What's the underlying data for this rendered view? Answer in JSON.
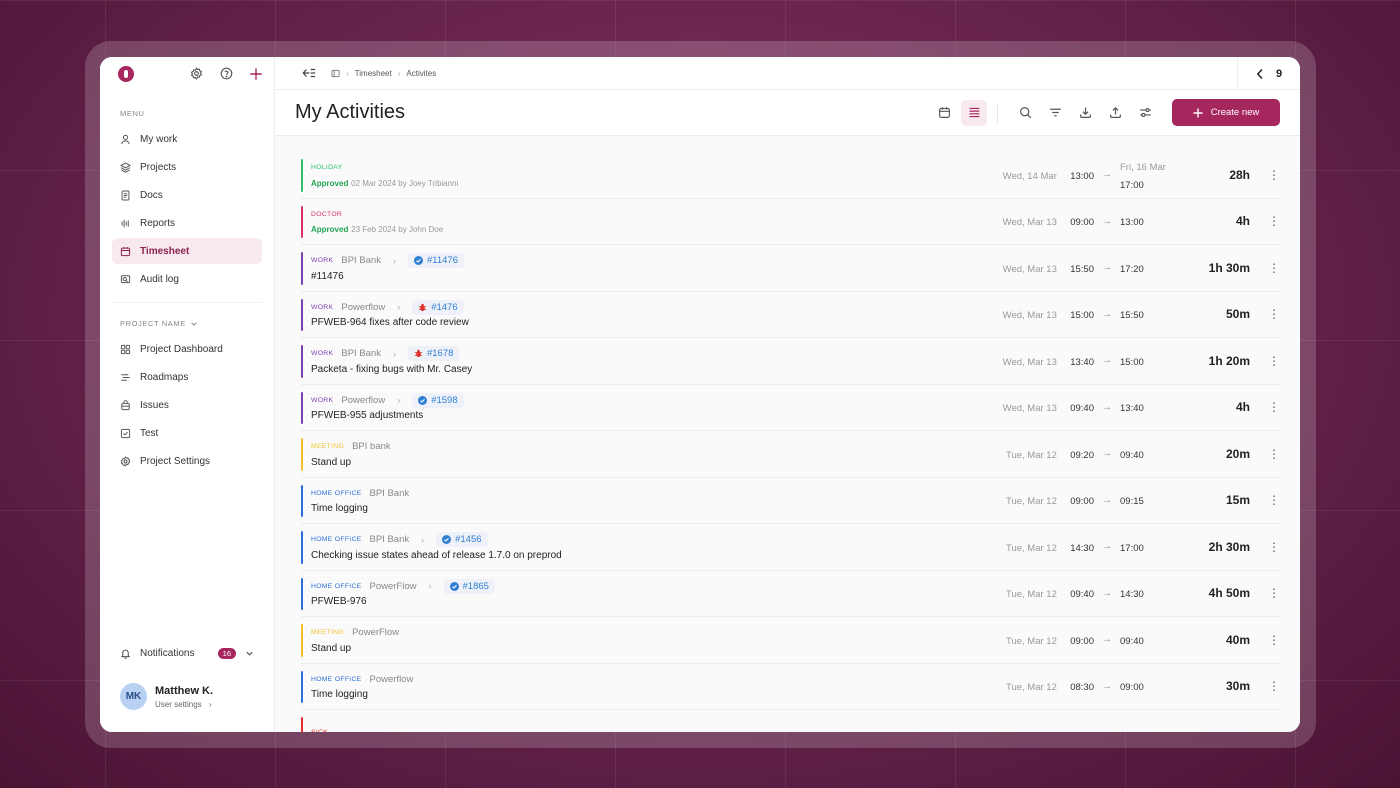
{
  "sidebar": {
    "menu_label": "MENU",
    "items": [
      {
        "label": "My work"
      },
      {
        "label": "Projects"
      },
      {
        "label": "Docs"
      },
      {
        "label": "Reports"
      },
      {
        "label": "Timesheet"
      },
      {
        "label": "Audit log"
      }
    ],
    "project_label": "PROJECT NAME",
    "project_items": [
      {
        "label": "Project Dashboard"
      },
      {
        "label": "Roadmaps"
      },
      {
        "label": "Issues"
      },
      {
        "label": "Test"
      },
      {
        "label": "Project Settings"
      }
    ],
    "notifications_label": "Notifications",
    "notifications_count": "16",
    "user": {
      "initials": "MK",
      "name": "Matthew K.",
      "settings": "User settings"
    }
  },
  "topbar": {
    "crumb1": "Timesheet",
    "crumb2": "Activites",
    "pager_value": "9"
  },
  "header": {
    "title": "My Activities",
    "create_label": "Create new"
  },
  "colors": {
    "accent": "#a6265e",
    "holiday": "#2fbf71",
    "doctor": "#d6336c",
    "work": "#7b3fb0",
    "meeting": "#f2c12e",
    "home_office": "#2b6fd6",
    "sick": "#e03131"
  },
  "activities": [
    {
      "category": "HOLIDAY",
      "color": "#2fbf71",
      "line2_status": "Approved",
      "line2_rest": "02 Mar 2024 by Joey Tribianni",
      "start_date": "Wed, 14 Mar",
      "start_time": "13:00",
      "end_date": "Fri, 16 Mar",
      "end_time": "17:00",
      "duration": "28h"
    },
    {
      "category": "DOCTOR",
      "color": "#d6336c",
      "line2_status": "Approved",
      "line2_rest": "23 Feb 2024 by John Doe",
      "start_date": "Wed, Mar 13",
      "start_time": "09:00",
      "end_time": "13:00",
      "duration": "4h"
    },
    {
      "category": "WORK",
      "color": "#7b3fb0",
      "project": "BPI Bank",
      "tag": "#11476",
      "tag_icon": "check-icon",
      "title": "#11476",
      "start_date": "Wed, Mar 13",
      "start_time": "15:50",
      "end_time": "17:20",
      "duration": "1h 30m"
    },
    {
      "category": "WORK",
      "color": "#7b3fb0",
      "project": "Powerflow",
      "tag": "#1476",
      "tag_icon": "bug-icon",
      "title": "PFWEB-964 fixes after code review",
      "start_date": "Wed, Mar 13",
      "start_time": "15:00",
      "end_time": "15:50",
      "duration": "50m"
    },
    {
      "category": "WORK",
      "color": "#7b3fb0",
      "project": "BPI Bank",
      "tag": "#1678",
      "tag_icon": "bug-icon",
      "title": "Packeta - fixing bugs with Mr. Casey",
      "start_date": "Wed, Mar 13",
      "start_time": "13:40",
      "end_time": "15:00",
      "duration": "1h 20m"
    },
    {
      "category": "WORK",
      "color": "#7b3fb0",
      "project": "Powerflow",
      "tag": "#1598",
      "tag_icon": "check-icon",
      "title": "PFWEB-955 adjustments",
      "start_date": "Wed, Mar 13",
      "start_time": "09:40",
      "end_time": "13:40",
      "duration": "4h"
    },
    {
      "category": "MEETING",
      "color": "#f2c12e",
      "project": "BPI bank",
      "title": "Stand up",
      "start_date": "Tue, Mar 12",
      "start_time": "09:20",
      "end_time": "09:40",
      "duration": "20m"
    },
    {
      "category": "HOME OFFICE",
      "color": "#2b6fd6",
      "project": "BPI Bank",
      "title": "Time logging",
      "start_date": "Tue, Mar 12",
      "start_time": "09:00",
      "end_time": "09:15",
      "duration": "15m"
    },
    {
      "category": "HOME OFFICE",
      "color": "#2b6fd6",
      "project": "BPI Bank",
      "tag": "#1456",
      "tag_icon": "check-icon",
      "title": "Checking issue states ahead of release 1.7.0 on preprod",
      "start_date": "Tue, Mar 12",
      "start_time": "14:30",
      "end_time": "17:00",
      "duration": "2h 30m"
    },
    {
      "category": "HOME OFFICE",
      "color": "#2b6fd6",
      "project": "PowerFlow",
      "tag": "#1865",
      "tag_icon": "check-icon",
      "title": "PFWEB-976",
      "start_date": "Tue, Mar 12",
      "start_time": "09:40",
      "end_time": "14:30",
      "duration": "4h 50m"
    },
    {
      "category": "MEETING",
      "color": "#f2c12e",
      "project": "PowerFlow",
      "title": "Stand up",
      "start_date": "Tue, Mar 12",
      "start_time": "09:00",
      "end_time": "09:40",
      "duration": "40m"
    },
    {
      "category": "HOME OFFICE",
      "color": "#2b6fd6",
      "project": "Powerflow",
      "title": "Time logging",
      "start_date": "Tue, Mar 12",
      "start_time": "08:30",
      "end_time": "09:00",
      "duration": "30m"
    },
    {
      "category": "SICK",
      "color": "#e03131"
    }
  ]
}
